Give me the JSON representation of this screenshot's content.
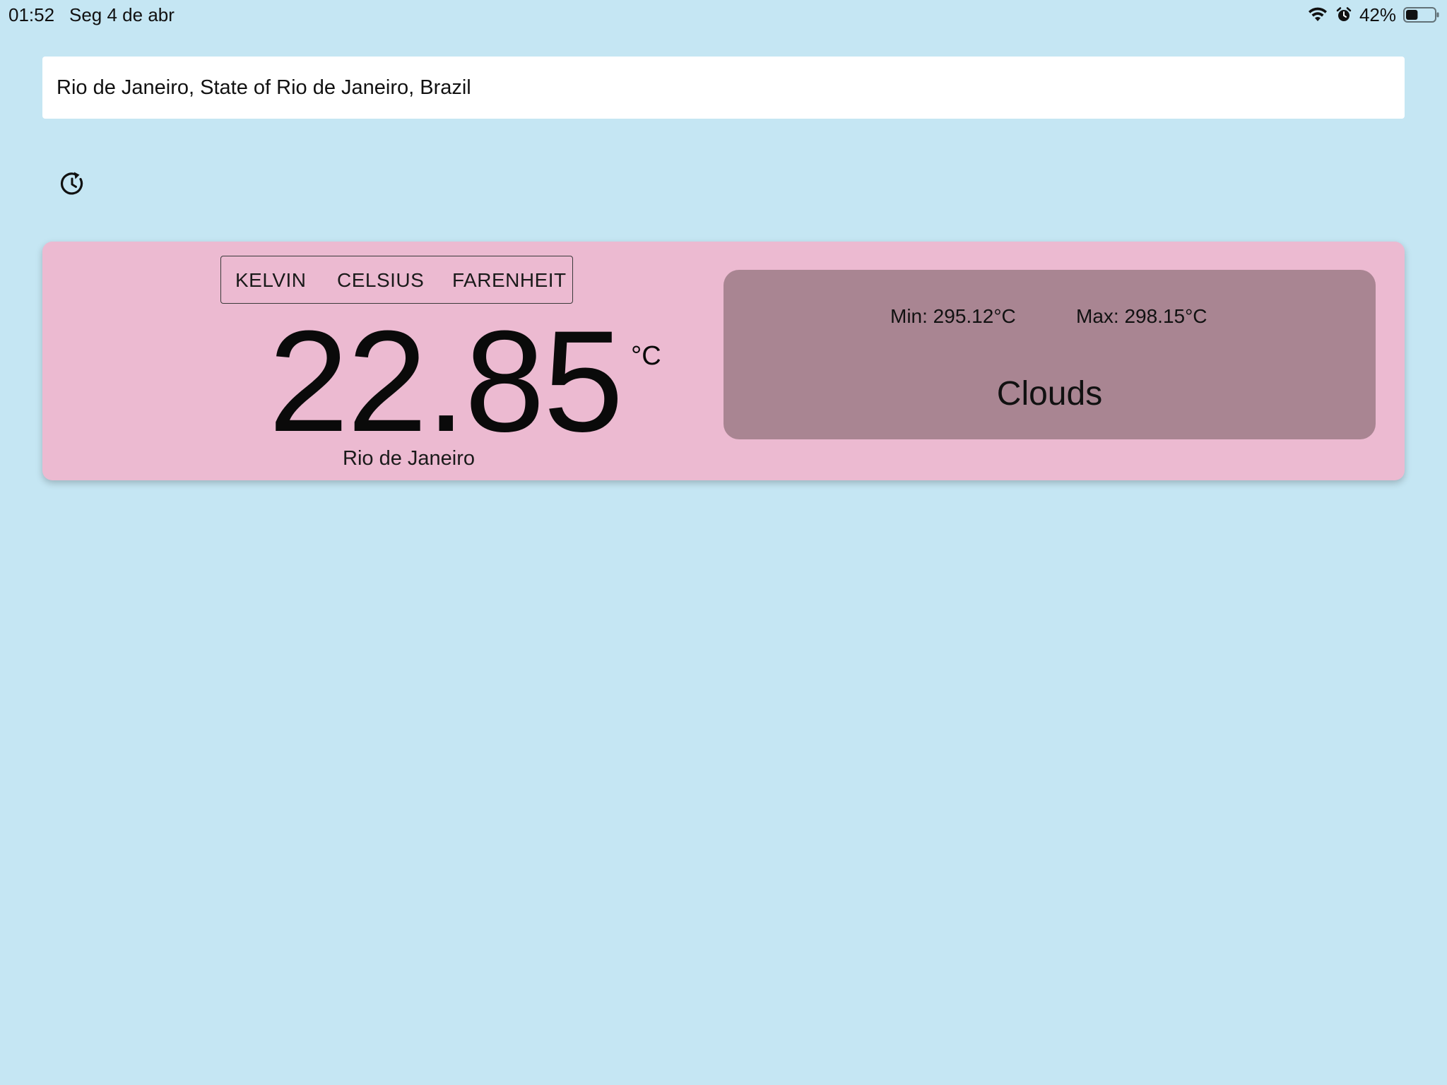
{
  "status_bar": {
    "time": "01:52",
    "date": "Seg 4 de abr",
    "battery_percent": "42%",
    "battery_level": 0.42,
    "icons": [
      "wifi-icon",
      "alarm-icon",
      "battery-icon"
    ]
  },
  "search": {
    "value": "Rio de Janeiro, State of Rio de Janeiro, Brazil"
  },
  "history_button": {
    "icon": "history-icon"
  },
  "weather": {
    "units": {
      "kelvin": "KELVIN",
      "celsius": "CELSIUS",
      "farenheit": "FARENHEIT",
      "selected": "CELSIUS"
    },
    "temperature": "22.85",
    "unit_symbol": "°C",
    "city": "Rio de Janeiro",
    "min": "Min: 295.12°C",
    "max": "Max: 298.15°C",
    "condition": "Clouds"
  },
  "colors": {
    "background": "#c5e6f3",
    "card": "#ecbad1",
    "details_panel": "#a98592",
    "input_background": "#ffffff"
  }
}
